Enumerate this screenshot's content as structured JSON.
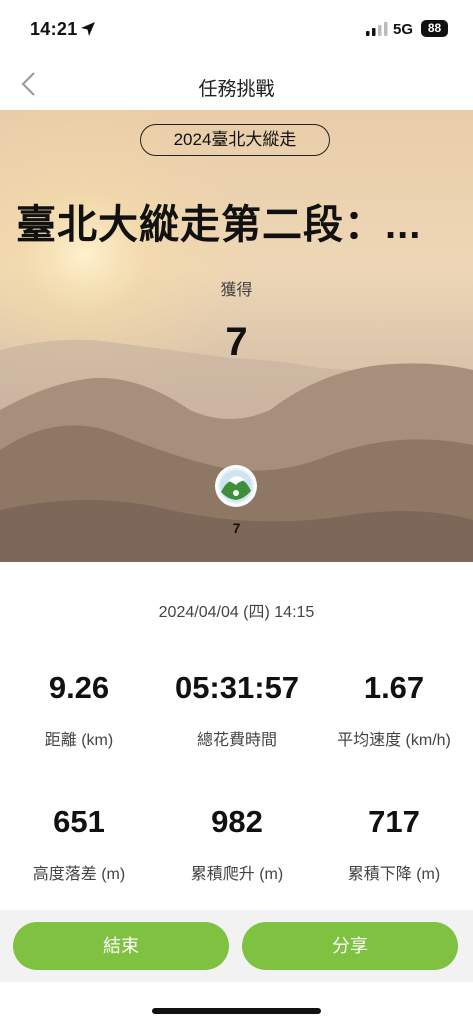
{
  "status_bar": {
    "time": "14:21",
    "network": "5G",
    "battery": "88",
    "icons": [
      "location-arrow-icon",
      "signal-icon"
    ]
  },
  "nav": {
    "title": "任務挑戰",
    "back_icon": "chevron-left-icon"
  },
  "hero": {
    "event_tag": "2024臺北大縱走",
    "title": "臺北大縱走第二段：...",
    "gain_label": "獲得",
    "gain_value": "7",
    "badge_icon": "mountain-badge-icon",
    "badge_count": "7"
  },
  "activity": {
    "datetime": "2024/04/04 (四) 14:15",
    "stats": [
      {
        "value": "9.26",
        "label": "距離 (km)"
      },
      {
        "value": "05:31:57",
        "label": "總花費時間"
      },
      {
        "value": "1.67",
        "label": "平均速度 (km/h)"
      },
      {
        "value": "651",
        "label": "高度落差 (m)"
      },
      {
        "value": "982",
        "label": "累積爬升 (m)"
      },
      {
        "value": "717",
        "label": "累積下降 (m)"
      }
    ]
  },
  "actions": {
    "end_label": "結束",
    "share_label": "分享"
  },
  "colors": {
    "accent_green": "#7fc241",
    "bottom_bar": "#f2f2f2"
  }
}
